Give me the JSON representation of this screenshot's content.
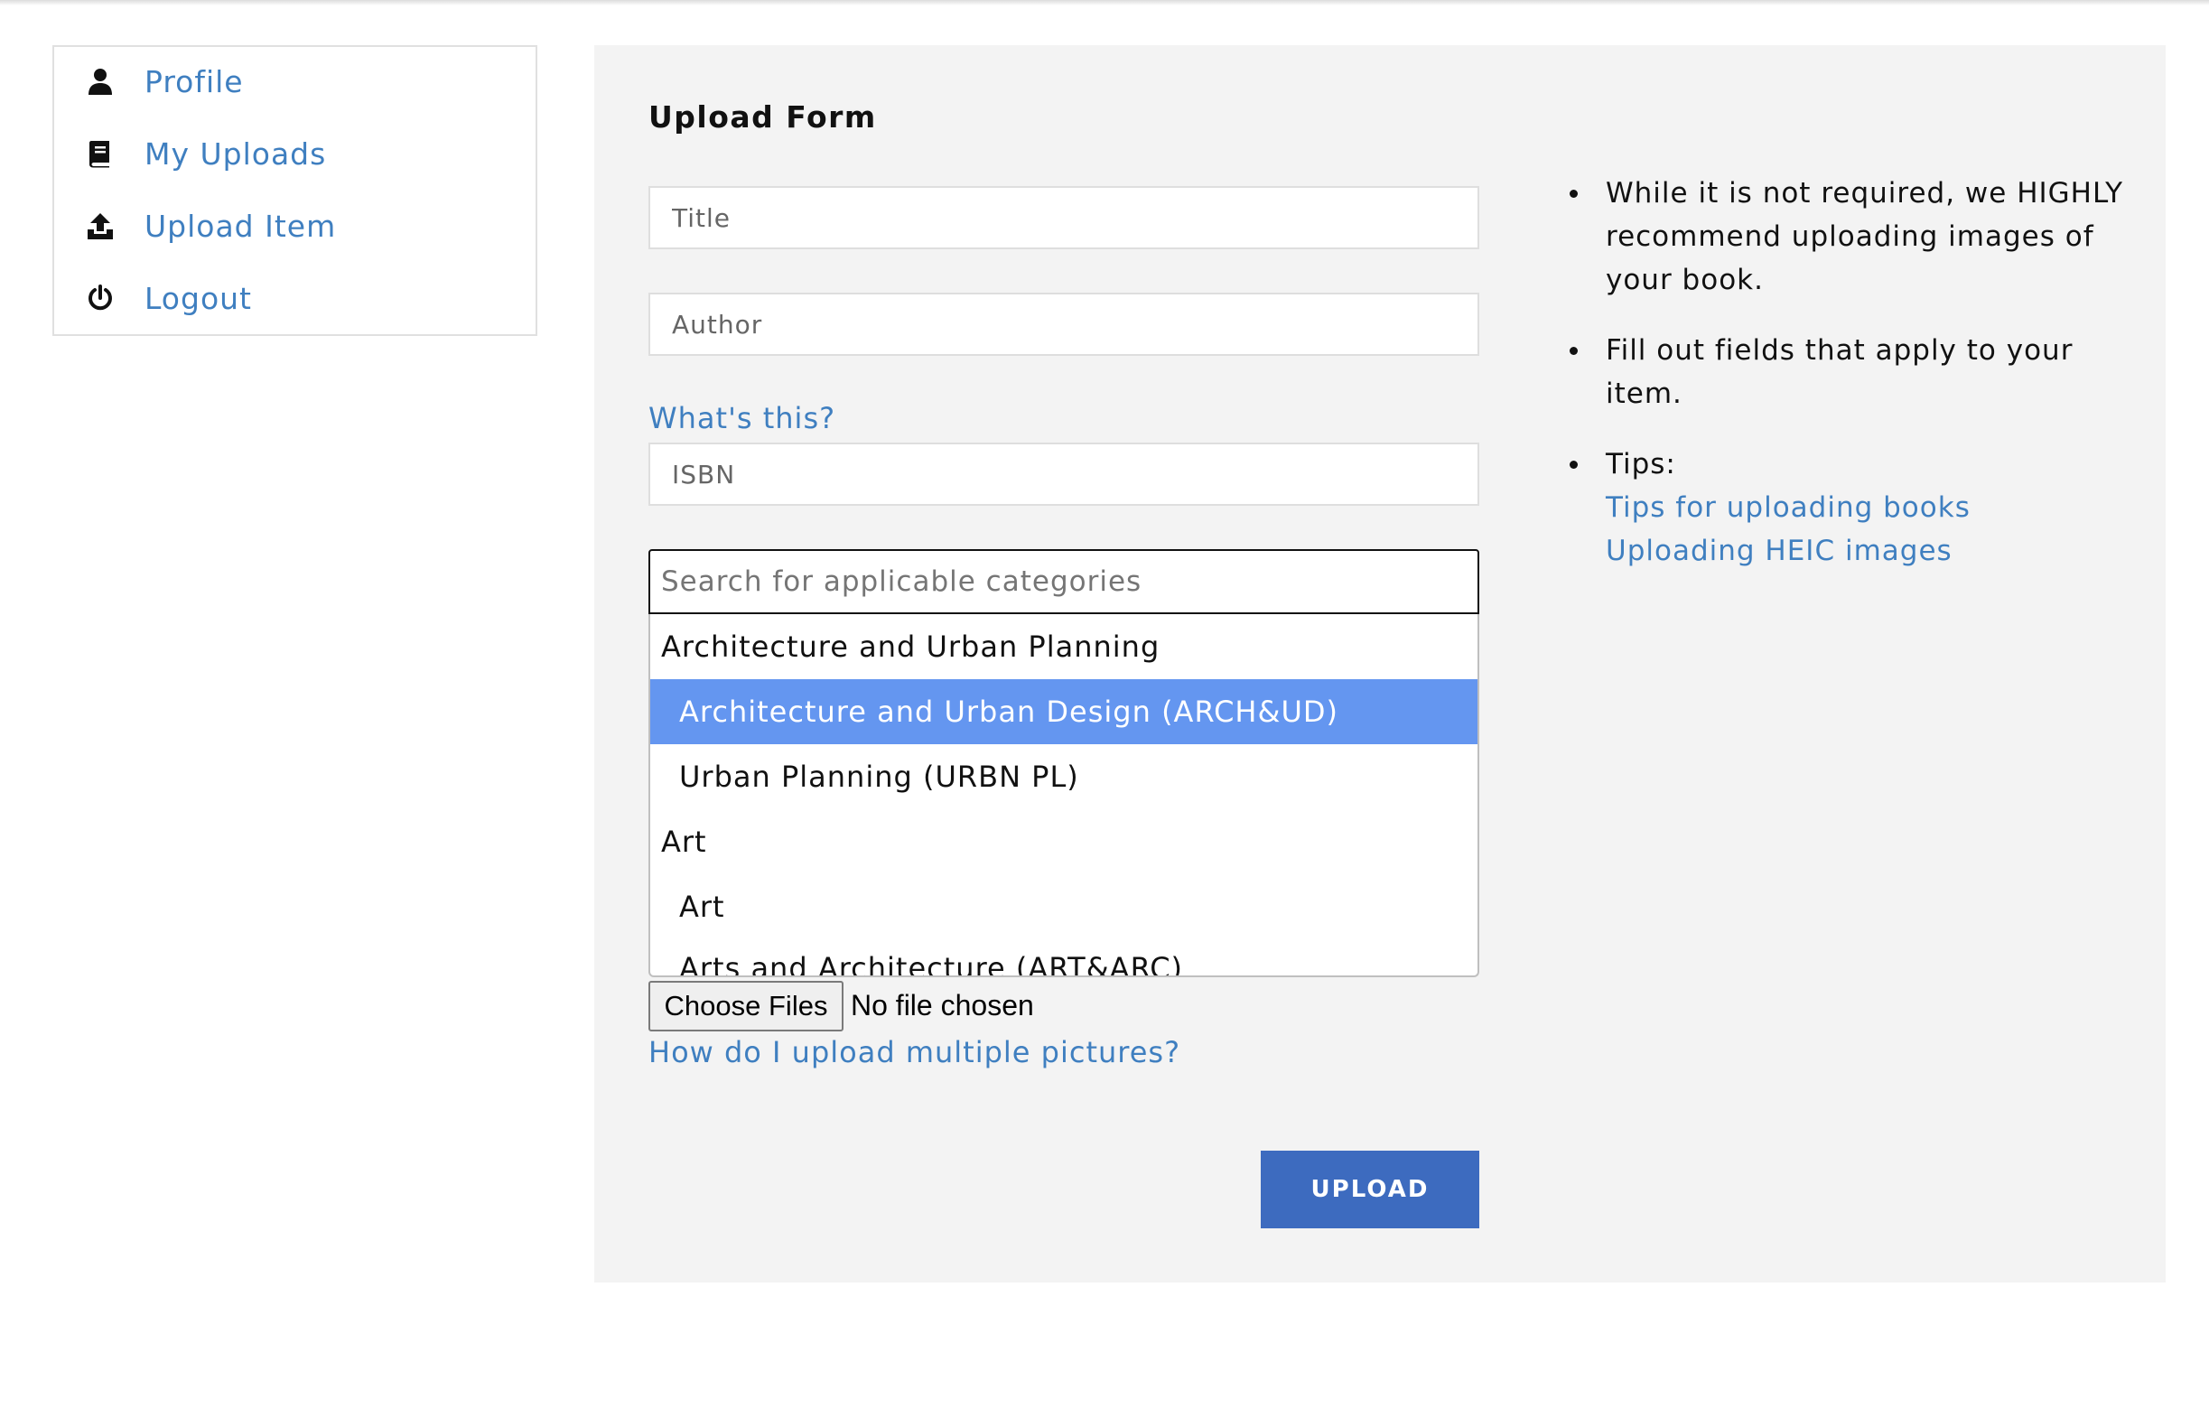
{
  "sidebar": {
    "items": [
      {
        "label": "Profile",
        "icon": "user-icon"
      },
      {
        "label": "My Uploads",
        "icon": "book-icon"
      },
      {
        "label": "Upload Item",
        "icon": "upload-icon"
      },
      {
        "label": "Logout",
        "icon": "power-icon"
      }
    ]
  },
  "form": {
    "title": "Upload Form",
    "title_placeholder": "Title",
    "author_placeholder": "Author",
    "isbn_help_link": "What's this?",
    "isbn_placeholder": "ISBN",
    "category_search_placeholder": "Search for applicable categories",
    "categories": [
      {
        "type": "group",
        "label": "Architecture and Urban Planning"
      },
      {
        "type": "option",
        "label": "Architecture and Urban Design (ARCH&UD)",
        "selected": true
      },
      {
        "type": "option",
        "label": "Urban Planning (URBN PL)"
      },
      {
        "type": "group",
        "label": "Art"
      },
      {
        "type": "option",
        "label": "Art"
      },
      {
        "type": "option",
        "label": "Arts and Architecture (ART&ARC)"
      }
    ],
    "file_button_label": "Choose Files",
    "file_status": "No file chosen",
    "multi_picture_link": "How do I upload multiple pictures?",
    "upload_button_label": "UPLOAD"
  },
  "notes": {
    "items": [
      "While it is not required, we HIGHLY recommend uploading images of your book.",
      "Fill out fields that apply to your item.",
      "Tips:"
    ],
    "tip_links": [
      "Tips for uploading books",
      "Uploading HEIC images"
    ]
  },
  "colors": {
    "link": "#3f7fc0",
    "selected_option": "#6496f0",
    "upload_button": "#3d6bbf",
    "panel_background": "#f3f3f3"
  }
}
